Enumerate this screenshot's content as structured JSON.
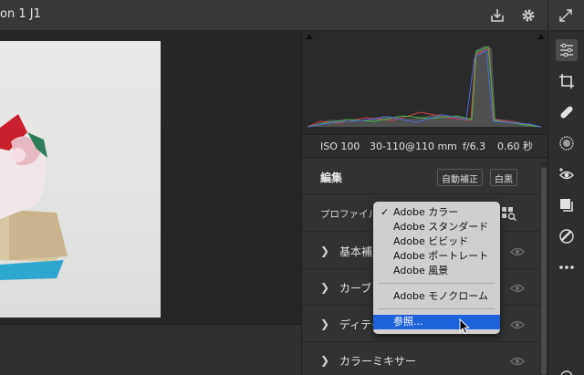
{
  "window": {
    "title": "on 1 J1"
  },
  "toolbar": {
    "export_icon": "export-icon",
    "settings_icon": "gear-icon",
    "fullscreen_icon": "expand-icon"
  },
  "exif": {
    "iso": "ISO 100",
    "lens": "30-110@110 mm",
    "aperture": "f/6.3",
    "shutter": "0.60 秒"
  },
  "edit": {
    "title": "編集",
    "auto_label": "自動補正",
    "bw_label": "白黒"
  },
  "profile": {
    "label": "プロファイル"
  },
  "sections": [
    {
      "label": "基本補正"
    },
    {
      "label": "カーブ"
    },
    {
      "label": "ディテール"
    },
    {
      "label": "カラーミキサー"
    }
  ],
  "profile_menu": {
    "items": [
      "Adobe カラー",
      "Adobe スタンダード",
      "Adobe ビビッド",
      "Adobe ポートレート",
      "Adobe 風景"
    ],
    "mono": "Adobe モノクローム",
    "browse": "参照...",
    "selected_index": 0
  },
  "right_tools": [
    "sliders-icon",
    "crop-icon",
    "healing-icon",
    "mask-icon",
    "red-eye-icon",
    "presets-icon",
    "snapshot-icon",
    "more-icon"
  ],
  "colors": {
    "accent": "#1d62d8",
    "panel": "#323232",
    "menu": "#cfcfcf"
  }
}
